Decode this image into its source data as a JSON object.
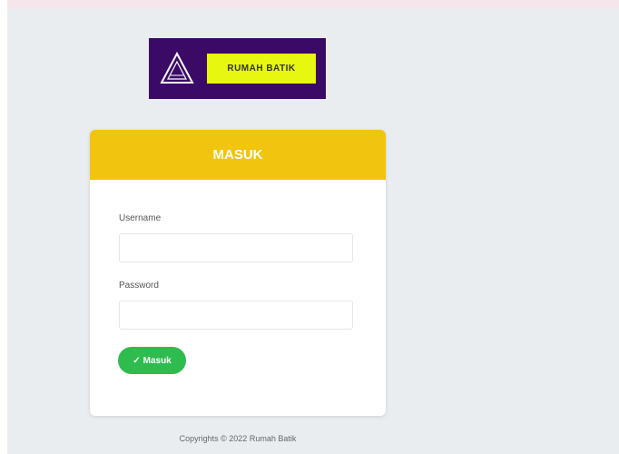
{
  "logo": {
    "text": "RUMAH BATIK",
    "icon": "triangle-emblem-icon",
    "colors": {
      "background": "#3b0a66",
      "label": "#e7f70f"
    }
  },
  "login_form": {
    "title": "MASUK",
    "username_label": "Username",
    "username_value": "",
    "password_label": "Password",
    "password_value": "",
    "submit_icon": "check-icon",
    "submit_label": "Masuk"
  },
  "footer": {
    "text": "Copyrights © 2022 Rumah Batik"
  },
  "colors": {
    "header": "#f1c40f",
    "button": "#2ebc4f",
    "page_background": "#e9edf0"
  }
}
